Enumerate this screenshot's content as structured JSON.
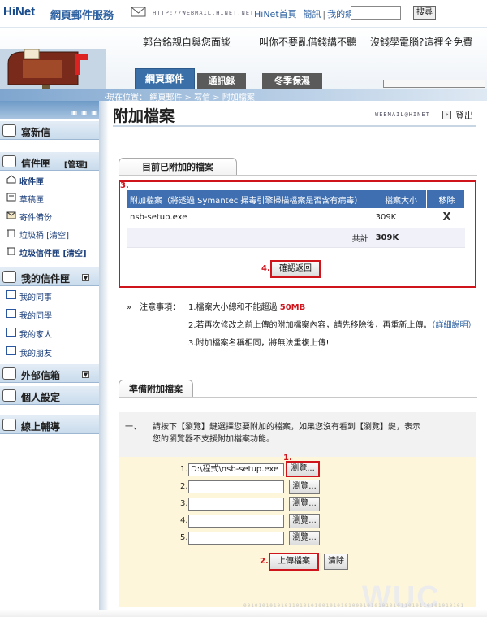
{
  "topbar": {
    "logo": "HiNet",
    "service_name": "網頁郵件服務",
    "url_text": "HTTP://WEBMAIL.HINET.NET",
    "links": [
      "HiNet首頁",
      "簡訊",
      "我的網頁"
    ],
    "search_button": "搜尋"
  },
  "header": {
    "slogans": [
      "郭台銘親自與您面談",
      "叫你不要亂借錢講不聽",
      "沒錢學電腦?這裡全免費"
    ]
  },
  "tabs": [
    "網頁郵件",
    "通訊錄",
    "冬季保濕"
  ],
  "breadcrumb": "‧現在位置： 網頁郵件 > 寫信 > 附加檔案",
  "sidebar": {
    "compose": "寫新信",
    "mailbox": "信件匣",
    "manage": "[管理]",
    "items": [
      {
        "label": "收件匣",
        "bold": true
      },
      {
        "label": "草稿匣",
        "bold": false
      },
      {
        "label": "寄件備份",
        "bold": false
      },
      {
        "label": "垃圾桶 [清空]",
        "bold": false
      },
      {
        "label": "垃圾信件匣 [清空]",
        "bold": true
      }
    ],
    "my_folders": "我的信件匣",
    "folders": [
      "我的同事",
      "我的同學",
      "我的家人",
      "我的朋友"
    ],
    "external": "外部信箱",
    "settings": "個人設定",
    "help": "線上輔導"
  },
  "main": {
    "title": "附加檔案",
    "brand": "WEBMAIL@HINET",
    "logout": "登出",
    "attached_tab": "目前已附加的檔案",
    "marker_3": "3.",
    "table": {
      "headers": [
        "附加檔案（將透過 Symantec 掃毒引擎掃描檔案是否含有病毒）",
        "檔案大小",
        "移除"
      ],
      "rows": [
        {
          "name": "nsb-setup.exe",
          "size": "309K",
          "remove": "X"
        }
      ],
      "total_label": "共計",
      "total_value": "309K"
    },
    "marker_4": "4.",
    "confirm_button": "確認返回",
    "notes_label": "»　注意事項：",
    "notes": {
      "n1_prefix": "1.檔案大小總和不能超過 ",
      "n1_limit": "50MB",
      "n2_text": "2.若再次修改之前上傳的附加檔案內容，請先移除後，再重新上傳。",
      "n2_link": "（詳細說明）",
      "n3": "3.附加檔案名稱相同，將無法重複上傳!"
    },
    "prepare_tab": "準備附加檔案",
    "prepare": {
      "step": "一、",
      "text1": "請按下【瀏覽】鍵選擇您要附加的檔案，如果您沒有看到【瀏覽】鍵，表示",
      "text2": "您的瀏覽器不支援附加檔案功能。"
    },
    "marker_1": "1.",
    "files": [
      {
        "label": "1.",
        "value": "D:\\程式\\nsb-setup.exe"
      },
      {
        "label": "2.",
        "value": ""
      },
      {
        "label": "3.",
        "value": ""
      },
      {
        "label": "4.",
        "value": ""
      },
      {
        "label": "5.",
        "value": ""
      }
    ],
    "browse_label": "瀏覽...",
    "marker_2": "2.",
    "upload_button": "上傳檔案",
    "clear_button": "清除"
  },
  "footer": {
    "binary": "00101010101011010101001010101000101010101011010110101010101",
    "watermark": "WUC"
  }
}
